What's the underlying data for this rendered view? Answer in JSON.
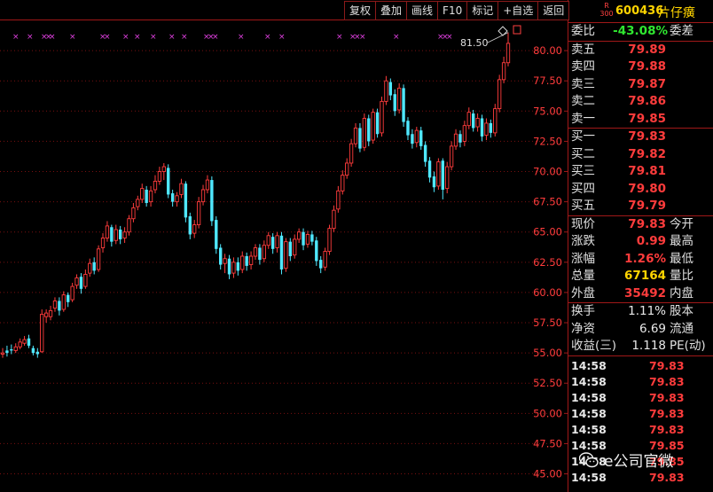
{
  "toolbar": {
    "buttons": [
      "复权",
      "叠加",
      "画线",
      "F10",
      "标记",
      "+自选",
      "返回"
    ]
  },
  "stock": {
    "badge_top": "R",
    "badge_bottom": "300",
    "code": "600436",
    "name": "片仔癀"
  },
  "order_ratio": {
    "label": "委比",
    "value": "-43.08%",
    "label2": "委差"
  },
  "asks": [
    {
      "label": "卖五",
      "price": "79.89"
    },
    {
      "label": "卖四",
      "price": "79.88"
    },
    {
      "label": "卖三",
      "price": "79.87"
    },
    {
      "label": "卖二",
      "price": "79.86"
    },
    {
      "label": "卖一",
      "price": "79.85"
    }
  ],
  "bids": [
    {
      "label": "买一",
      "price": "79.83"
    },
    {
      "label": "买二",
      "price": "79.82"
    },
    {
      "label": "买三",
      "price": "79.81"
    },
    {
      "label": "买四",
      "price": "79.80"
    },
    {
      "label": "买五",
      "price": "79.79"
    }
  ],
  "quote": [
    {
      "label": "现价",
      "value": "79.83",
      "label2": "今开",
      "color": "red"
    },
    {
      "label": "涨跌",
      "value": "0.99",
      "label2": "最高",
      "color": "red"
    },
    {
      "label": "涨幅",
      "value": "1.26%",
      "label2": "最低",
      "color": "red"
    },
    {
      "label": "总量",
      "value": "67164",
      "label2": "量比",
      "color": "yellow"
    },
    {
      "label": "外盘",
      "value": "35492",
      "label2": "内盘",
      "color": "red"
    }
  ],
  "fundamentals": [
    {
      "label": "换手",
      "value": "1.11%",
      "label2": "股本"
    },
    {
      "label": "净资",
      "value": "6.69",
      "label2": "流通"
    },
    {
      "label": "收益(三)",
      "value": "1.118",
      "label2": "PE(动)"
    }
  ],
  "ticks": [
    {
      "time": "14:58",
      "price": "79.83"
    },
    {
      "time": "14:58",
      "price": "79.83"
    },
    {
      "time": "14:58",
      "price": "79.83"
    },
    {
      "time": "14:58",
      "price": "79.83"
    },
    {
      "time": "14:58",
      "price": "79.83"
    },
    {
      "time": "14:58",
      "price": "79.85"
    },
    {
      "time": "14:58",
      "price": "79.85"
    },
    {
      "time": "14:58",
      "price": "79.83"
    }
  ],
  "watermark": "e公司官微",
  "chart_data": {
    "type": "candlestick",
    "y_ticks": [
      "80.00",
      "77.50",
      "75.00",
      "72.50",
      "70.00",
      "67.50",
      "65.00",
      "62.50",
      "60.00",
      "57.50",
      "55.00",
      "52.50",
      "50.00",
      "47.50",
      "45.00"
    ],
    "ylim": [
      43.5,
      82.5
    ],
    "max_label": "81.50",
    "colors": {
      "up": "#ff3c3c",
      "down": "#4fe8ff",
      "grid": "#7a1010",
      "axis": "#a01818",
      "marker": "#e040e0"
    },
    "candles": [
      [
        54.9,
        55.0,
        54.6,
        55.4
      ],
      [
        55.2,
        55.0,
        54.7,
        55.6
      ],
      [
        55.3,
        55.2,
        54.9,
        55.7
      ],
      [
        55.2,
        55.5,
        55.0,
        55.8
      ],
      [
        55.5,
        55.9,
        55.3,
        56.2
      ],
      [
        55.8,
        56.1,
        55.6,
        56.4
      ],
      [
        56.2,
        55.6,
        55.4,
        56.5
      ],
      [
        55.4,
        55.0,
        54.8,
        55.6
      ],
      [
        55.1,
        54.9,
        54.6,
        55.4
      ],
      [
        55.1,
        58.2,
        55.0,
        58.6
      ],
      [
        58.0,
        58.3,
        57.5,
        58.6
      ],
      [
        58.0,
        58.5,
        57.7,
        58.9
      ],
      [
        58.7,
        59.3,
        58.4,
        59.6
      ],
      [
        59.3,
        58.5,
        58.1,
        59.6
      ],
      [
        58.6,
        59.8,
        58.4,
        60.1
      ],
      [
        59.8,
        59.2,
        58.8,
        60.0
      ],
      [
        59.4,
        60.5,
        59.2,
        60.8
      ],
      [
        60.6,
        61.2,
        60.3,
        61.5
      ],
      [
        61.3,
        60.3,
        59.9,
        61.6
      ],
      [
        60.5,
        61.5,
        60.3,
        61.9
      ],
      [
        61.6,
        62.4,
        61.3,
        62.8
      ],
      [
        62.5,
        61.8,
        61.5,
        62.9
      ],
      [
        61.9,
        63.6,
        61.7,
        63.9
      ],
      [
        63.7,
        64.5,
        63.3,
        64.9
      ],
      [
        64.5,
        65.5,
        64.2,
        65.9
      ],
      [
        65.4,
        64.2,
        63.8,
        65.6
      ],
      [
        64.3,
        65.2,
        64.0,
        65.6
      ],
      [
        65.2,
        64.4,
        64.0,
        65.5
      ],
      [
        64.5,
        65.0,
        64.1,
        65.4
      ],
      [
        65.0,
        66.1,
        64.7,
        66.4
      ],
      [
        66.1,
        67.0,
        65.8,
        67.4
      ],
      [
        67.1,
        67.7,
        66.8,
        68.0
      ],
      [
        67.7,
        68.6,
        67.4,
        69.0
      ],
      [
        68.5,
        67.4,
        67.1,
        68.8
      ],
      [
        67.5,
        68.4,
        67.1,
        68.8
      ],
      [
        68.5,
        69.2,
        68.2,
        69.7
      ],
      [
        69.2,
        70.0,
        68.9,
        70.4
      ],
      [
        70.0,
        70.4,
        69.3,
        70.7
      ],
      [
        70.3,
        68.1,
        67.8,
        70.6
      ],
      [
        68.2,
        67.5,
        67.1,
        68.5
      ],
      [
        67.5,
        68.0,
        67.1,
        68.3
      ],
      [
        68.1,
        69.0,
        67.8,
        69.4
      ],
      [
        69.0,
        66.2,
        65.8,
        69.2
      ],
      [
        66.3,
        64.8,
        64.4,
        66.6
      ],
      [
        64.9,
        65.6,
        64.5,
        66.0
      ],
      [
        65.6,
        67.5,
        65.3,
        67.9
      ],
      [
        67.5,
        68.5,
        67.2,
        68.9
      ],
      [
        68.5,
        69.3,
        68.2,
        69.7
      ],
      [
        69.3,
        65.9,
        65.5,
        69.6
      ],
      [
        66.0,
        63.6,
        63.2,
        66.3
      ],
      [
        63.7,
        62.3,
        61.9,
        64.0
      ],
      [
        62.4,
        62.8,
        61.6,
        63.2
      ],
      [
        62.8,
        61.5,
        61.1,
        63.1
      ],
      [
        61.6,
        62.5,
        61.2,
        62.9
      ],
      [
        62.5,
        61.8,
        61.4,
        62.9
      ],
      [
        61.9,
        63.0,
        61.6,
        63.4
      ],
      [
        63.0,
        62.2,
        61.8,
        63.3
      ],
      [
        62.3,
        63.0,
        61.9,
        63.4
      ],
      [
        63.0,
        63.7,
        62.7,
        64.0
      ],
      [
        63.7,
        62.7,
        62.3,
        64.0
      ],
      [
        62.8,
        63.9,
        62.5,
        64.3
      ],
      [
        63.9,
        64.7,
        63.6,
        65.0
      ],
      [
        64.6,
        63.6,
        63.2,
        64.9
      ],
      [
        63.7,
        64.7,
        63.3,
        65.0
      ],
      [
        64.7,
        61.9,
        61.5,
        65.0
      ],
      [
        62.0,
        64.2,
        61.7,
        64.5
      ],
      [
        64.2,
        63.0,
        62.6,
        64.5
      ],
      [
        63.1,
        64.4,
        62.8,
        64.8
      ],
      [
        64.4,
        65.0,
        64.1,
        65.3
      ],
      [
        65.0,
        63.9,
        63.5,
        65.3
      ],
      [
        64.0,
        64.8,
        63.7,
        65.1
      ],
      [
        64.8,
        64.2,
        63.9,
        65.1
      ],
      [
        64.3,
        62.6,
        62.2,
        64.6
      ],
      [
        62.7,
        62.0,
        61.6,
        63.0
      ],
      [
        62.1,
        63.4,
        61.8,
        63.7
      ],
      [
        63.4,
        65.3,
        63.1,
        65.6
      ],
      [
        65.3,
        66.8,
        65.0,
        67.2
      ],
      [
        66.9,
        68.4,
        66.6,
        68.8
      ],
      [
        68.4,
        69.7,
        68.1,
        70.1
      ],
      [
        69.7,
        70.7,
        69.4,
        71.1
      ],
      [
        70.7,
        72.3,
        70.4,
        72.7
      ],
      [
        72.3,
        73.6,
        72.0,
        74.0
      ],
      [
        73.6,
        71.9,
        71.6,
        74.0
      ],
      [
        72.0,
        74.4,
        71.7,
        74.8
      ],
      [
        74.4,
        72.5,
        72.1,
        74.7
      ],
      [
        72.6,
        74.9,
        72.3,
        75.2
      ],
      [
        74.9,
        73.1,
        72.8,
        75.2
      ],
      [
        73.2,
        75.8,
        72.9,
        76.2
      ],
      [
        75.8,
        77.5,
        75.5,
        77.9
      ],
      [
        77.4,
        76.3,
        75.9,
        77.7
      ],
      [
        76.4,
        75.0,
        74.6,
        76.8
      ],
      [
        75.1,
        76.9,
        74.8,
        77.3
      ],
      [
        76.9,
        74.1,
        73.7,
        77.2
      ],
      [
        74.2,
        73.0,
        72.6,
        74.5
      ],
      [
        73.1,
        72.3,
        71.9,
        73.5
      ],
      [
        72.4,
        73.4,
        72.0,
        73.7
      ],
      [
        73.4,
        72.1,
        71.8,
        73.7
      ],
      [
        72.2,
        70.8,
        70.4,
        72.5
      ],
      [
        70.9,
        69.5,
        69.1,
        71.2
      ],
      [
        69.6,
        68.7,
        68.3,
        70.0
      ],
      [
        68.8,
        70.8,
        68.5,
        71.1
      ],
      [
        70.9,
        68.5,
        67.7,
        71.1
      ],
      [
        68.6,
        70.4,
        68.2,
        70.8
      ],
      [
        70.4,
        72.1,
        70.1,
        72.5
      ],
      [
        72.1,
        73.1,
        71.8,
        73.5
      ],
      [
        73.1,
        72.4,
        72.0,
        73.4
      ],
      [
        72.5,
        73.8,
        72.1,
        74.2
      ],
      [
        73.8,
        74.9,
        73.5,
        75.3
      ],
      [
        74.8,
        73.6,
        73.3,
        75.1
      ],
      [
        73.7,
        74.4,
        73.3,
        74.8
      ],
      [
        74.4,
        72.9,
        72.5,
        74.7
      ],
      [
        73.0,
        74.0,
        72.6,
        74.4
      ],
      [
        74.0,
        73.2,
        72.8,
        74.3
      ],
      [
        73.2,
        75.2,
        72.9,
        75.6
      ],
      [
        75.2,
        77.6,
        74.9,
        78.0
      ],
      [
        77.6,
        79.0,
        77.3,
        79.5
      ],
      [
        79.0,
        80.6,
        78.7,
        81.5
      ]
    ]
  }
}
